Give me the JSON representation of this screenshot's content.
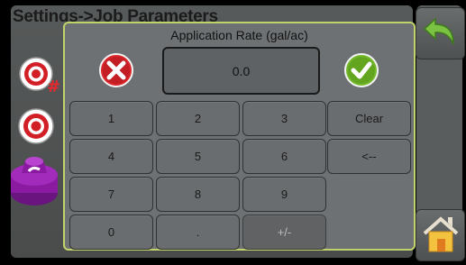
{
  "page": {
    "title": "Settings->Job Parameters"
  },
  "sidebar": {
    "icons": [
      {
        "name": "target-hash-icon"
      },
      {
        "name": "target-icon"
      },
      {
        "name": "spray-nozzle-icon"
      }
    ]
  },
  "rightbar": {
    "back": {
      "icon": "back-arrow-icon"
    },
    "home": {
      "icon": "home-icon"
    }
  },
  "dialog": {
    "title": "Application Rate (gal/ac)",
    "value": "0.0",
    "cancel_icon": "cancel-x-icon",
    "confirm_icon": "confirm-check-icon",
    "keys": [
      {
        "label": "1",
        "name": "key-1"
      },
      {
        "label": "2",
        "name": "key-2"
      },
      {
        "label": "3",
        "name": "key-3"
      },
      {
        "label": "Clear",
        "name": "key-clear"
      },
      {
        "label": "4",
        "name": "key-4"
      },
      {
        "label": "5",
        "name": "key-5"
      },
      {
        "label": "6",
        "name": "key-6"
      },
      {
        "label": "<--",
        "name": "key-backspace"
      },
      {
        "label": "7",
        "name": "key-7"
      },
      {
        "label": "8",
        "name": "key-8"
      },
      {
        "label": "9",
        "name": "key-9"
      },
      {
        "label": "0",
        "name": "key-0"
      },
      {
        "label": ".",
        "name": "key-decimal"
      },
      {
        "label": "+/-",
        "name": "key-plus-minus"
      }
    ]
  },
  "colors": {
    "dialog_border": "#c0d36a",
    "cancel_red": "#d9262b",
    "confirm_green": "#74b82e",
    "accent_purple": "#8a1aa0"
  }
}
